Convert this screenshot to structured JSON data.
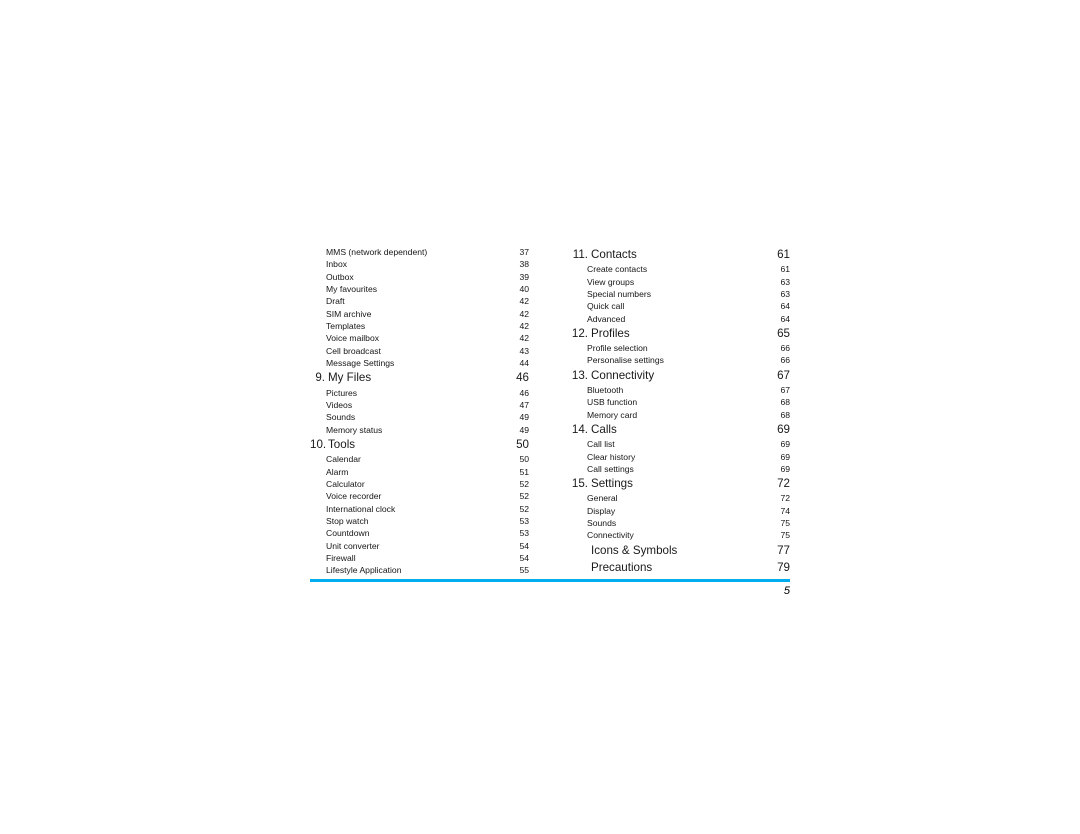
{
  "document": {
    "folio": "5",
    "rule_color": "#00aeef"
  },
  "toc": {
    "left_column": [
      {
        "type": "entry",
        "num": "",
        "label": "MMS (network dependent)",
        "page": "37"
      },
      {
        "type": "entry",
        "num": "",
        "label": "Inbox",
        "page": "38"
      },
      {
        "type": "entry",
        "num": "",
        "label": "Outbox",
        "page": "39"
      },
      {
        "type": "entry",
        "num": "",
        "label": "My favourites",
        "page": "40"
      },
      {
        "type": "entry",
        "num": "",
        "label": "Draft",
        "page": "42"
      },
      {
        "type": "entry",
        "num": "",
        "label": "SIM archive",
        "page": "42"
      },
      {
        "type": "entry",
        "num": "",
        "label": "Templates",
        "page": "42"
      },
      {
        "type": "entry",
        "num": "",
        "label": "Voice mailbox",
        "page": "42"
      },
      {
        "type": "entry",
        "num": "",
        "label": "Cell broadcast",
        "page": "43"
      },
      {
        "type": "entry",
        "num": "",
        "label": "Message Settings",
        "page": "44"
      },
      {
        "type": "chapter",
        "num": "9.",
        "label": "My Files",
        "page": "46"
      },
      {
        "type": "entry",
        "num": "",
        "label": "Pictures",
        "page": "46"
      },
      {
        "type": "entry",
        "num": "",
        "label": "Videos",
        "page": "47"
      },
      {
        "type": "entry",
        "num": "",
        "label": "Sounds",
        "page": "49"
      },
      {
        "type": "entry",
        "num": "",
        "label": "Memory status",
        "page": "49"
      },
      {
        "type": "chapter",
        "num": "10.",
        "label": "Tools",
        "page": "50"
      },
      {
        "type": "entry",
        "num": "",
        "label": "Calendar",
        "page": "50"
      },
      {
        "type": "entry",
        "num": "",
        "label": "Alarm",
        "page": "51"
      },
      {
        "type": "entry",
        "num": "",
        "label": "Calculator",
        "page": "52"
      },
      {
        "type": "entry",
        "num": "",
        "label": "Voice recorder",
        "page": "52"
      },
      {
        "type": "entry",
        "num": "",
        "label": "International clock",
        "page": "52"
      },
      {
        "type": "entry",
        "num": "",
        "label": "Stop watch",
        "page": "53"
      },
      {
        "type": "entry",
        "num": "",
        "label": "Countdown",
        "page": "53"
      },
      {
        "type": "entry",
        "num": "",
        "label": "Unit converter",
        "page": "54"
      },
      {
        "type": "entry",
        "num": "",
        "label": "Firewall",
        "page": "54"
      },
      {
        "type": "entry",
        "num": "",
        "label": "Lifestyle Application",
        "page": "55"
      }
    ],
    "right_column": [
      {
        "type": "chapter",
        "num": "11.",
        "label": "Contacts",
        "page": "61"
      },
      {
        "type": "entry",
        "num": "",
        "label": "Create contacts",
        "page": "61"
      },
      {
        "type": "entry",
        "num": "",
        "label": "View groups",
        "page": "63"
      },
      {
        "type": "entry",
        "num": "",
        "label": "Special numbers",
        "page": "63"
      },
      {
        "type": "entry",
        "num": "",
        "label": "Quick call",
        "page": "64"
      },
      {
        "type": "entry",
        "num": "",
        "label": "Advanced",
        "page": "64"
      },
      {
        "type": "chapter",
        "num": "12.",
        "label": "Profiles",
        "page": "65"
      },
      {
        "type": "entry",
        "num": "",
        "label": "Profile selection",
        "page": "66"
      },
      {
        "type": "entry",
        "num": "",
        "label": "Personalise settings",
        "page": "66"
      },
      {
        "type": "chapter",
        "num": "13.",
        "label": "Connectivity",
        "page": "67"
      },
      {
        "type": "entry",
        "num": "",
        "label": "Bluetooth",
        "page": "67"
      },
      {
        "type": "entry",
        "num": "",
        "label": "USB function",
        "page": "68"
      },
      {
        "type": "entry",
        "num": "",
        "label": "Memory card",
        "page": "68"
      },
      {
        "type": "chapter",
        "num": "14.",
        "label": "Calls",
        "page": "69"
      },
      {
        "type": "entry",
        "num": "",
        "label": "Call list",
        "page": "69"
      },
      {
        "type": "entry",
        "num": "",
        "label": "Clear history",
        "page": "69"
      },
      {
        "type": "entry",
        "num": "",
        "label": "Call settings",
        "page": "69"
      },
      {
        "type": "chapter",
        "num": "15.",
        "label": "Settings",
        "page": "72"
      },
      {
        "type": "entry",
        "num": "",
        "label": "General",
        "page": "72"
      },
      {
        "type": "entry",
        "num": "",
        "label": "Display",
        "page": "74"
      },
      {
        "type": "entry",
        "num": "",
        "label": "Sounds",
        "page": "75"
      },
      {
        "type": "entry",
        "num": "",
        "label": "Connectivity",
        "page": "75"
      },
      {
        "type": "chapter",
        "num": "",
        "label": "Icons & Symbols",
        "page": "77"
      },
      {
        "type": "chapter",
        "num": "",
        "label": "Precautions",
        "page": "79"
      }
    ]
  }
}
